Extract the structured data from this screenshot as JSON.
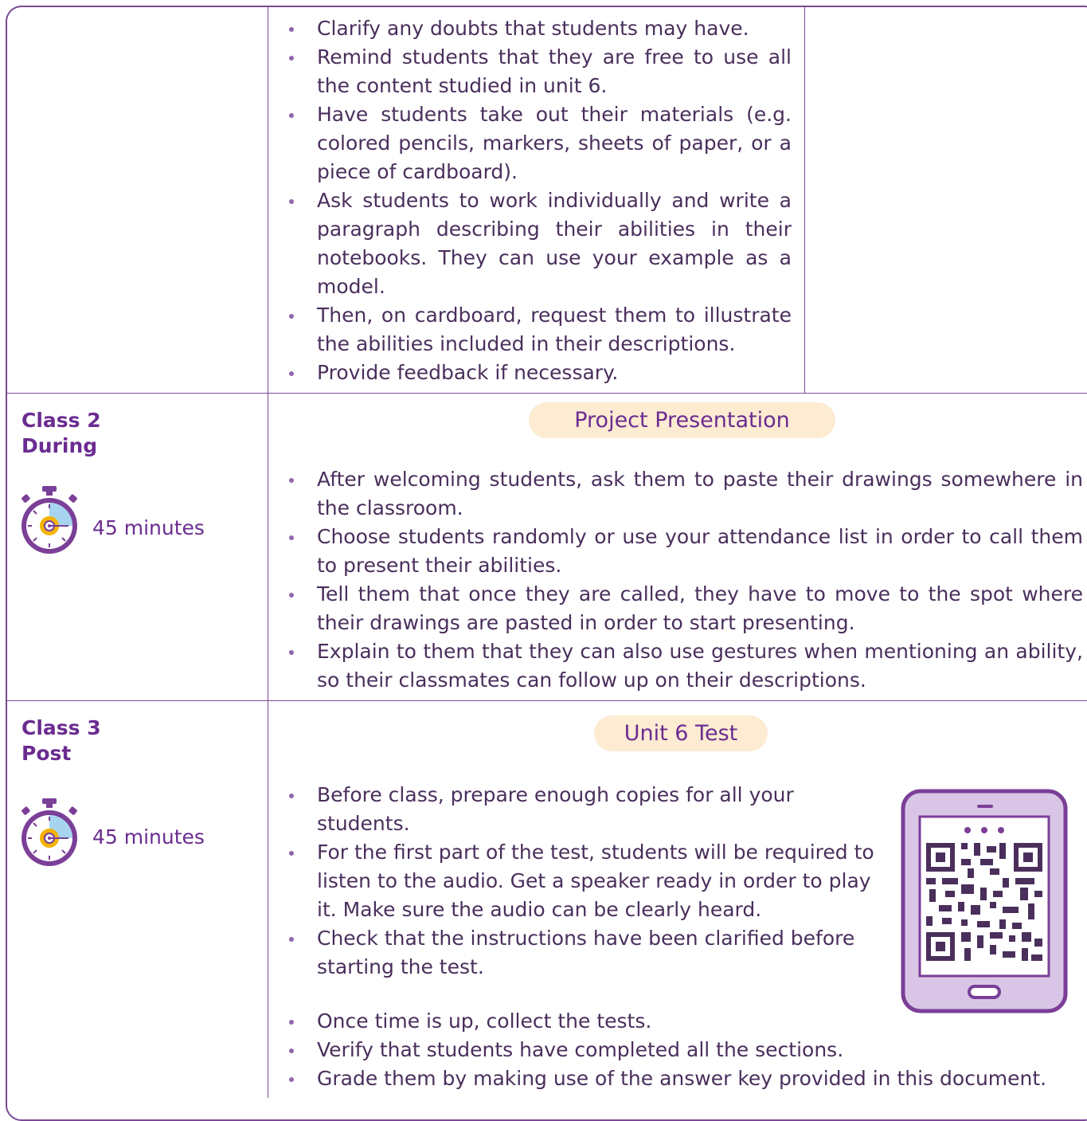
{
  "row1": {
    "bullets": [
      "Clarify any doubts that students may have.",
      "Remind students that they are free to use all the content studied in unit 6.",
      "Have students take out their materials (e.g. colored pencils, markers, sheets of paper, or a piece of cardboard).",
      "Ask students to work individually and write a paragraph describing their abilities in their notebooks. They can use your example as a model.",
      "Then, on cardboard, request them to illustrate the abilities included in their descriptions.",
      "Provide feedback if necessary."
    ]
  },
  "row2": {
    "label_line1": "Class 2",
    "label_line2": "During",
    "duration": "45 minutes",
    "heading": "Project Presentation",
    "bullets": [
      "After welcoming students, ask them to paste their drawings somewhere in the classroom.",
      "Choose students randomly or use your attendance list in order to call them to present their abilities.",
      "Tell them that once they are called, they have to move to the spot where their drawings are pasted in order to start presenting.",
      "Explain to them that they can also use gestures when mentioning an ability, so their classmates can follow up on their descriptions."
    ]
  },
  "row3": {
    "label_line1": "Class 3",
    "label_line2": "Post",
    "duration": "45 minutes",
    "heading": "Unit 6 Test",
    "bullets": [
      "Before class, prepare enough copies for all your students.",
      "For the first part of the test, students will be required to listen to the audio. Get a speaker ready in order to play it. Make sure the audio can be clearly heard.",
      "Check that the instructions have been clarified before starting the test."
    ],
    "bullets_full": [
      "Once time is up, collect the tests.",
      "Verify that students have completed all the sections.",
      "Grade them by making use of the answer key provided in this document."
    ]
  },
  "icons": {
    "timer": "stopwatch-icon",
    "tablet": "tablet-qr-code-icon"
  },
  "colors": {
    "border": "#7b4a96",
    "label": "#6b2c91",
    "pill": "#fdebd2",
    "tablet": "#d9c6e6"
  }
}
